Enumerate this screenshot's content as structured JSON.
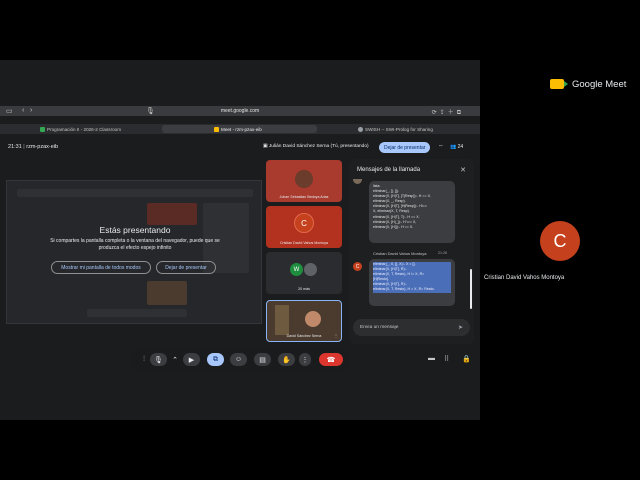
{
  "app": {
    "name": "Google Meet"
  },
  "side_participant": {
    "initial": "C",
    "name": "Cristian David Vahos Montoya"
  },
  "browser": {
    "url": "meet.google.com",
    "tabs": [
      {
        "label": "Programación II - 2026-2 Classroom",
        "color": "#34a853"
      },
      {
        "label": "Meet - rzm-pzax-eib",
        "color": "#fbbc04"
      },
      {
        "label": "SWISH -- SWI-Prolog for Sharing",
        "color": "#9aa0a6"
      }
    ]
  },
  "meeting": {
    "time": "21:31",
    "code": "rzm-pzax-eib",
    "presenting_label": "Julián David Sánchez Serna (Tú, presentando)",
    "stop_presenting": "Dejar de presentar",
    "people_count": "24"
  },
  "presenting_panel": {
    "title": "Estás presentando",
    "description": "Si compartes la pantalla completa o la ventana del navegador, puede que se produzca el efecto espejo infinito",
    "show_all_tabs": "Mostrar mi pantalla de todos modos",
    "stop": "Dejar de presentar"
  },
  "participants": [
    {
      "name": "Johan Sebastian Bedoya Arias",
      "initial": "",
      "tile_color": "#a83a2e"
    },
    {
      "name": "Cristian David Vahos Montoya",
      "initial": "C",
      "tile_color": "#b3321f"
    },
    {
      "name": "20 más",
      "initial": "W",
      "tile_color": "#2b2c2f"
    },
    {
      "name": "David Sánchez Serna",
      "initial": "",
      "tile_color": "#4a3b2e"
    }
  ],
  "chat": {
    "title": "Mensajes de la llamada",
    "first_bubble": [
      "lista:",
      "eliminar(_, [], []).",
      "eliminar(X, [H|T], [T|Resp]):- H == X.",
      "eliminar(X, _, Resp).",
      "eliminar(X, [H|T], [H|Resp]):- H\\==",
      "X, eliminar(X, T, Resp).",
      "eliminar(X, [H|T], T):- H == X.",
      "eliminar(X, [H|_]):- H \\== X,",
      "eliminar(X, [H|]):- H == X."
    ],
    "sender": {
      "initial": "C",
      "name": "Cristian David Vahos Montoya",
      "time": "21:26"
    },
    "second_bubble": [
      "eliminar(_, X, [], X):- X = [].",
      "eliminar(X, [H|T], R):-",
      "eliminar(X, T, Resto), H \\= X, R=",
      "[H|Resto].",
      "eliminar(X, [H|T], R):-",
      "eliminar(X, T, Resto), H = X, R= Resto."
    ],
    "input_placeholder": "Envía un mensaje"
  }
}
